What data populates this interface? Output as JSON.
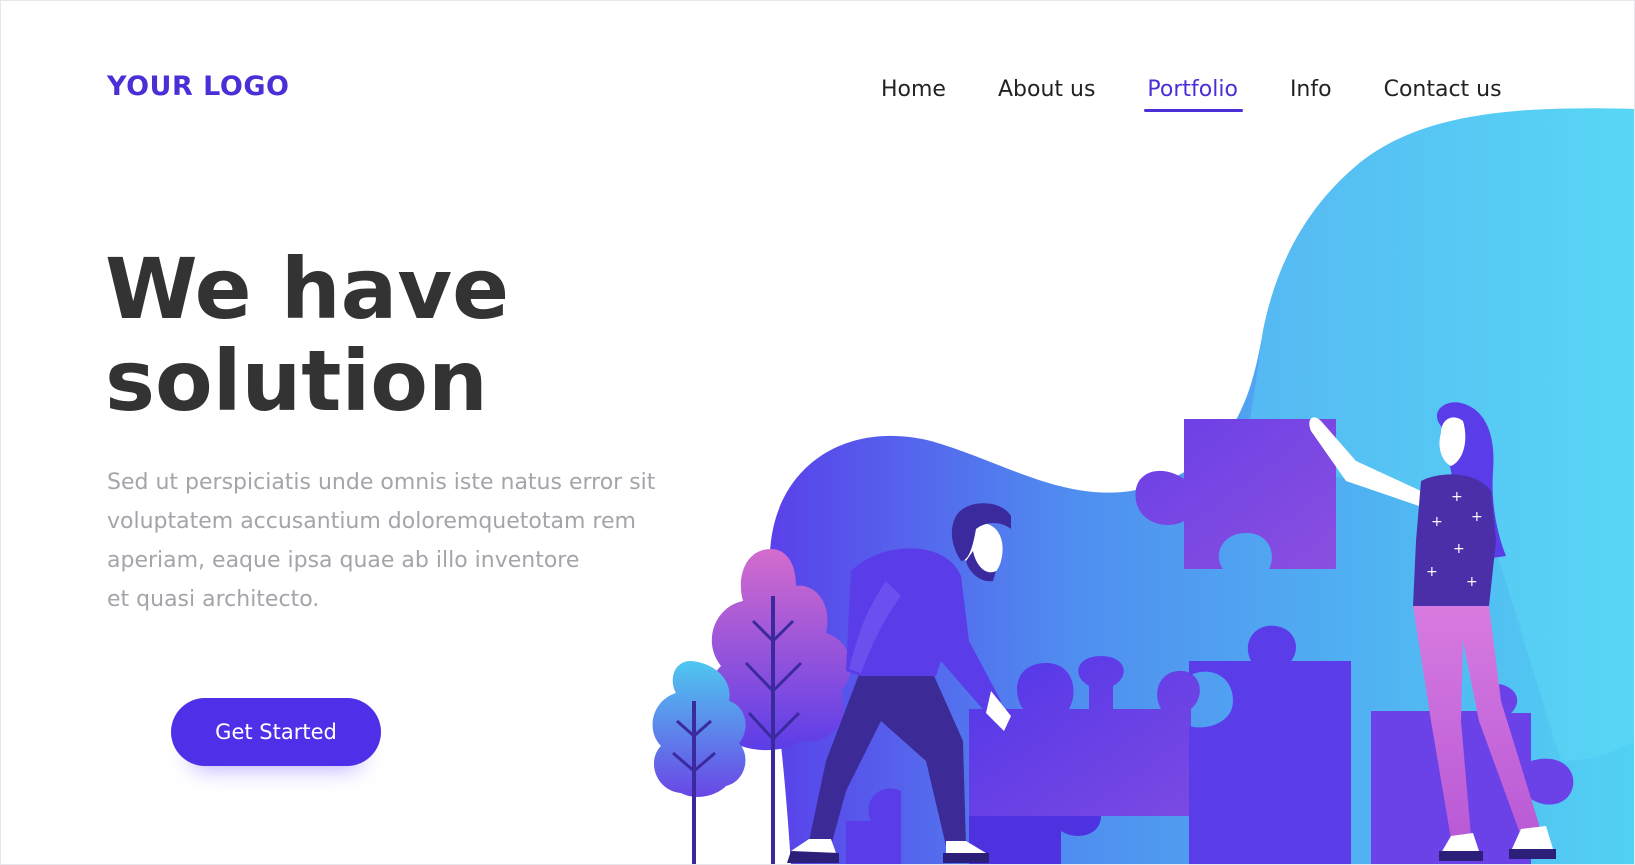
{
  "header": {
    "logo": "YOUR LOGO",
    "nav": [
      {
        "label": "Home",
        "active": false
      },
      {
        "label": "About us",
        "active": false
      },
      {
        "label": "Portfolio",
        "active": true
      },
      {
        "label": "Info",
        "active": false
      },
      {
        "label": "Contact us",
        "active": false
      }
    ]
  },
  "hero": {
    "title_line1": "We have",
    "title_line2": "solution",
    "body_lines": [
      "Sed ut perspiciatis unde omnis iste natus error sit",
      "voluptatem accusantium doloremquetotam rem",
      "aperiam, eaque ipsa quae ab illo inventore",
      "et quasi architecto."
    ],
    "cta_label": "Get Started"
  },
  "illustration": {
    "subject": "two people assembling jigsaw puzzle pieces",
    "icons": [
      "blob-background",
      "puzzle-piece",
      "tree",
      "man-figure",
      "woman-figure"
    ]
  },
  "colors": {
    "brand": "#4a2fd6",
    "heading": "#333333",
    "body_text": "#a4a4aa",
    "button": "#4f2fe8",
    "blob_light": "#55d0f2",
    "blob_dark": "#5d3bea",
    "puzzle": "#5b3de8",
    "pink": "#d06dd8"
  }
}
